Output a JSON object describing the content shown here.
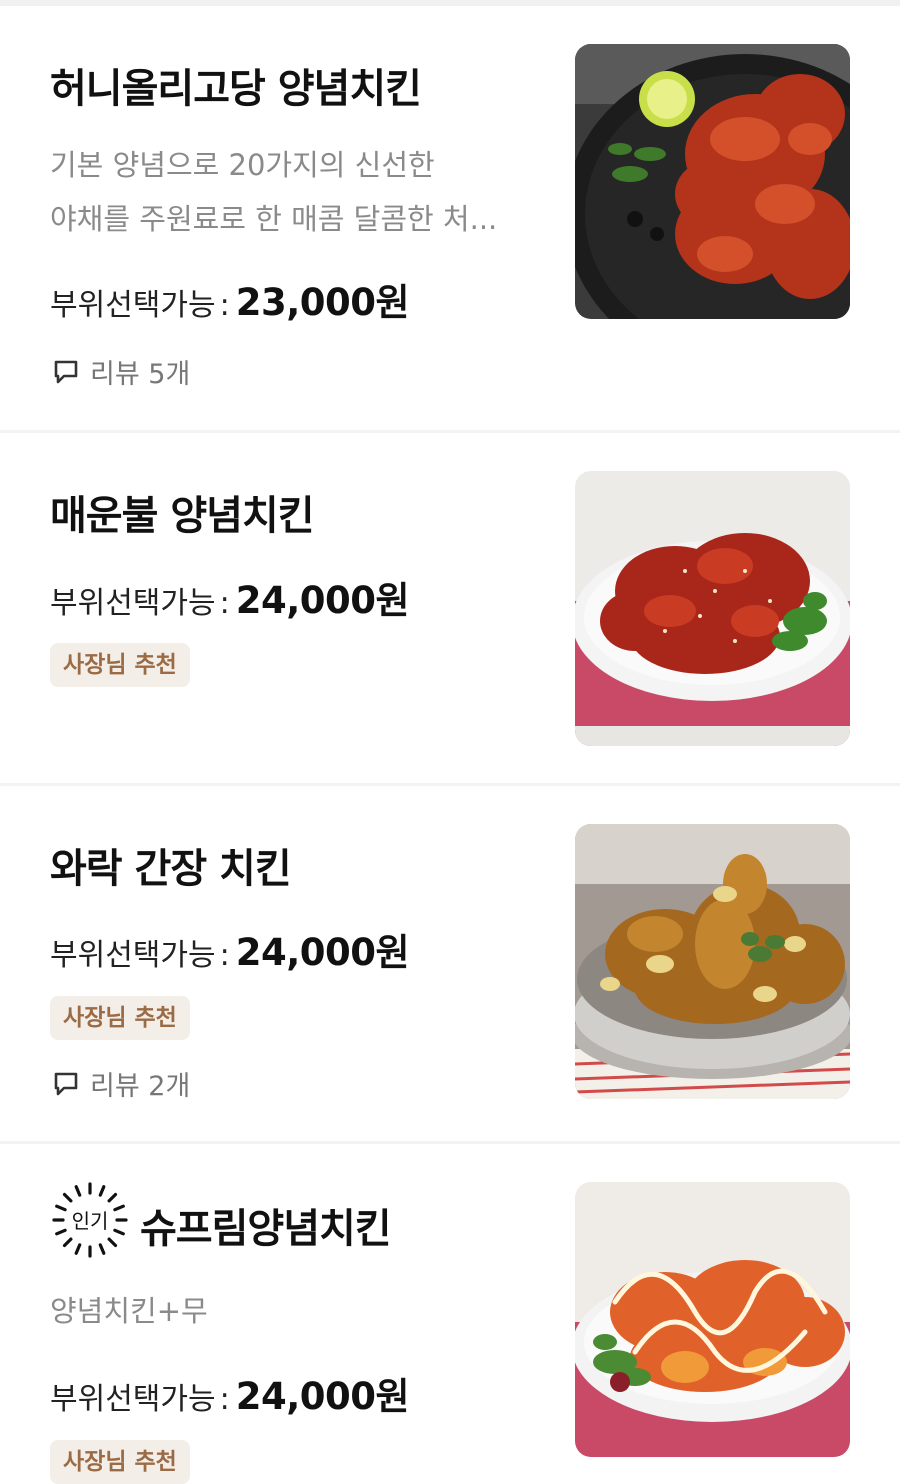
{
  "menu": [
    {
      "name": "허니올리고당 양념치킨",
      "description_line1": "기본 양념으로 20가지의 신선한",
      "description_line2": "야채를 주원료로 한 매콤 달콤한 처...",
      "price_prefix": "부위선택가능",
      "price": "23,000원",
      "review_label": "리뷰 5개",
      "image_icon": "honey-chicken-image"
    },
    {
      "name": "매운불 양념치킨",
      "price_prefix": "부위선택가능",
      "price": "24,000원",
      "badge": "사장님 추천",
      "image_icon": "spicy-chicken-image"
    },
    {
      "name": "와락 간장 치킨",
      "price_prefix": "부위선택가능",
      "price": "24,000원",
      "badge": "사장님 추천",
      "review_label": "리뷰 2개",
      "image_icon": "soy-chicken-image"
    },
    {
      "name": "슈프림양념치킨",
      "popular_label": "인기",
      "description_line1": "양념치킨+무",
      "price_prefix": "부위선택가능",
      "price": "24,000원",
      "badge": "사장님 추천",
      "image_icon": "supreme-chicken-image"
    }
  ],
  "colors": {
    "badge_bg": "#f3eee8",
    "badge_text": "#9b6b45",
    "description_text": "#8a8a8a",
    "divider": "#f3f3f3"
  }
}
